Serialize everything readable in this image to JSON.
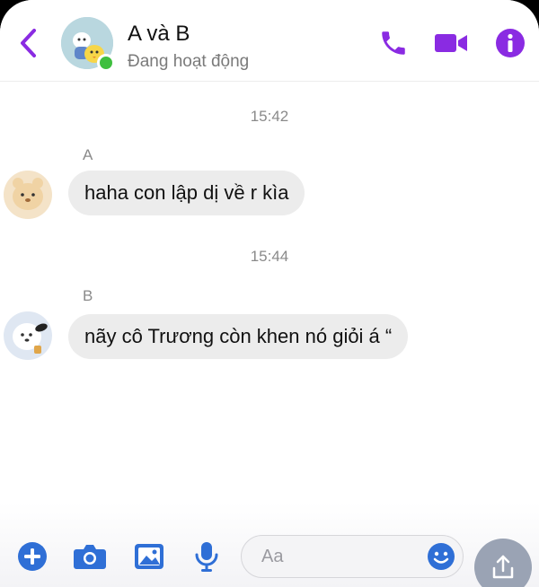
{
  "header": {
    "title": "A và B",
    "status": "Đang hoạt động",
    "accent_color": "#8a2be2",
    "icons": [
      "chevron-left-icon",
      "phone-icon",
      "video-camera-icon",
      "info-icon"
    ]
  },
  "messages": [
    {
      "time": "15:42",
      "sender": "A",
      "text": "haha con lập dị về r kìa"
    },
    {
      "time": "15:44",
      "sender": "B",
      "text": "nãy cô Trương còn khen nó giỏi á “"
    }
  ],
  "composer": {
    "placeholder": "Aa",
    "icons": [
      "plus-icon",
      "camera-icon",
      "image-icon",
      "microphone-icon",
      "emoji-icon",
      "share-icon"
    ]
  }
}
